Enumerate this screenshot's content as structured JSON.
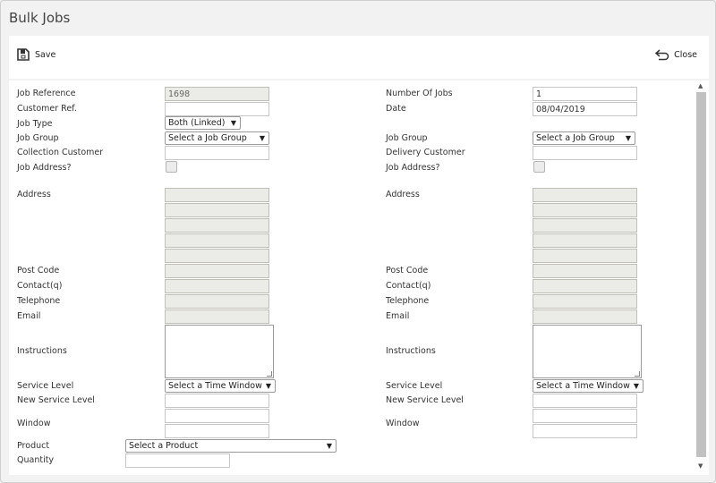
{
  "window": {
    "title": "Bulk Jobs"
  },
  "toolbar": {
    "save_label": "Save",
    "close_label": "Close"
  },
  "left": {
    "job_reference_label": "Job Reference",
    "job_reference_value": "1698",
    "customer_ref_label": "Customer Ref.",
    "customer_ref_value": "",
    "job_type_label": "Job Type",
    "job_type_value": "Both (Linked)",
    "job_group_label": "Job Group",
    "job_group_value": "Select a Job Group",
    "collection_customer_label": "Collection Customer",
    "collection_customer_value": "",
    "job_address_label": "Job Address?",
    "address_label": "Address",
    "post_code_label": "Post Code",
    "contact_label": "Contact(q)",
    "telephone_label": "Telephone",
    "email_label": "Email",
    "instructions_label": "Instructions",
    "service_level_label": "Service Level",
    "service_level_value": "Select a Time Window",
    "new_service_level_label": "New Service Level",
    "window_label": "Window",
    "product_label": "Product",
    "product_value": "Select a Product",
    "quantity_label": "Quantity"
  },
  "right": {
    "number_of_jobs_label": "Number Of Jobs",
    "number_of_jobs_value": "1",
    "date_label": "Date",
    "date_value": "08/04/2019",
    "job_group_label": "Job Group",
    "job_group_value": "Select a Job Group",
    "delivery_customer_label": "Delivery Customer",
    "delivery_customer_value": "",
    "job_address_label": "Job Address?",
    "address_label": "Address",
    "post_code_label": "Post Code",
    "contact_label": "Contact(q)",
    "telephone_label": "Telephone",
    "email_label": "Email",
    "instructions_label": "Instructions",
    "service_level_label": "Service Level",
    "service_level_value": "Select a Time Window",
    "new_service_level_label": "New Service Level",
    "window_label": "Window"
  },
  "icons": {
    "save": "save-icon",
    "close": "return-arrow-icon",
    "dropdown": "triangle-down-icon"
  }
}
